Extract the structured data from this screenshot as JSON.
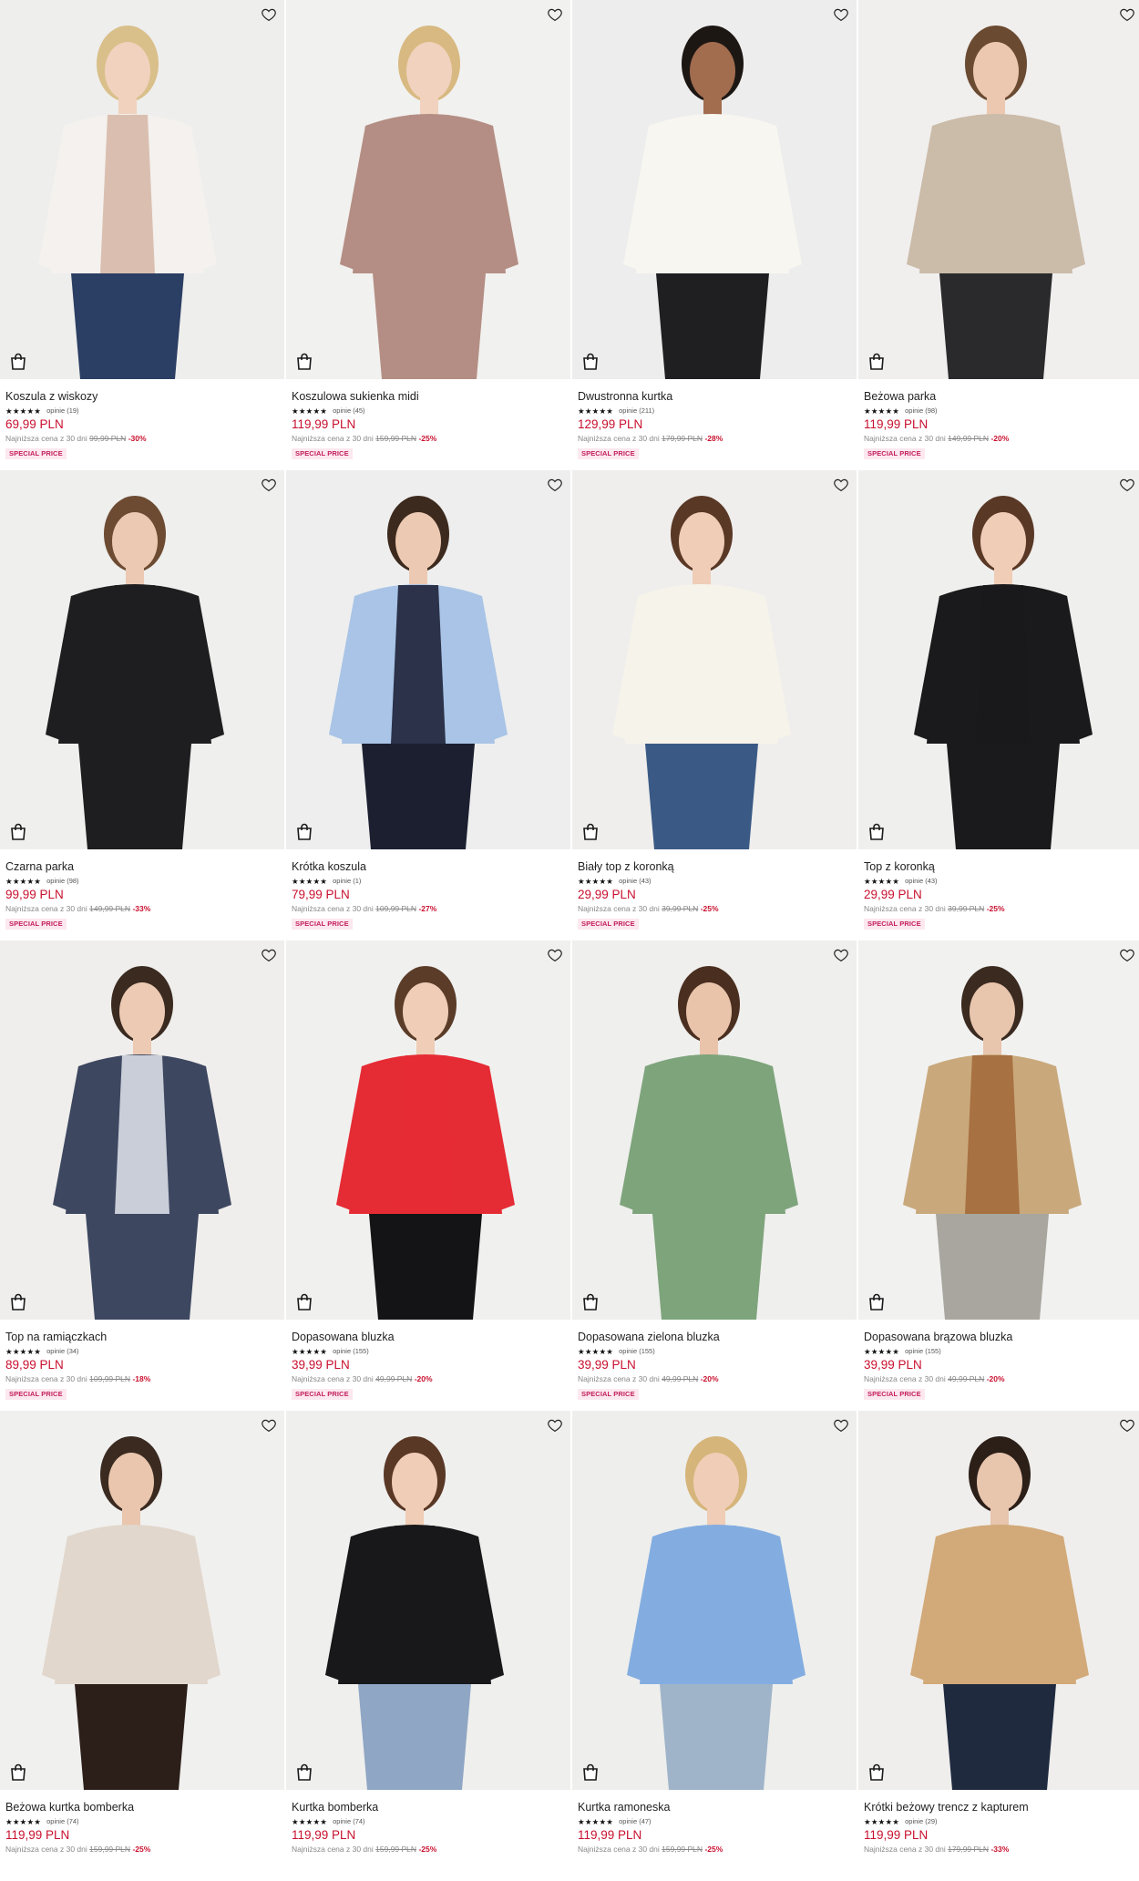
{
  "ui": {
    "wishlist_icon": "heart-outline-icon",
    "cart_icon": "shopping-bag-icon",
    "reviews_word": "opinie",
    "lowest_prefix": "Najniższa cena z 30 dni",
    "star_color": "#111111",
    "price_color": "#c8102e",
    "badge_bg": "#fde8ef",
    "badge_fg": "#c31e5c"
  },
  "products": [
    {
      "name": "Koszula z wiskozy",
      "stars": "★★★★★",
      "reviews": "opinie (19)",
      "price": "69,99 PLN",
      "lowest_label": "Najniższa cena z 30 dni",
      "lowest_old": "99,99 PLN",
      "discount": "-30%",
      "badge": "SPECIAL PRICE",
      "bg": "#eeeeec",
      "top": "#f4f1ee",
      "top2": "#d7b9a8",
      "bottom": "#2b3e63",
      "hair": "#d9bf8a",
      "skin": "#f0d2be"
    },
    {
      "name": "Koszulowa sukienka midi",
      "stars": "★★★★★",
      "reviews": "opinie (45)",
      "price": "119,99 PLN",
      "lowest_label": "Najniższa cena z 30 dni",
      "lowest_old": "159,99 PLN",
      "discount": "-25%",
      "badge": "SPECIAL PRICE",
      "bg": "#f1f1ef",
      "top": "#b48e84",
      "top2": "#b48e84",
      "bottom": "#b48e84",
      "hair": "#d8b981",
      "skin": "#f0d2be"
    },
    {
      "name": "Dwustronna kurtka",
      "stars": "★★★★★",
      "reviews": "opinie (211)",
      "price": "129,99 PLN",
      "lowest_label": "Najniższa cena z 30 dni",
      "lowest_old": "179,99 PLN",
      "discount": "-28%",
      "badge": "SPECIAL PRICE",
      "bg": "#ededed",
      "top": "#f7f6f1",
      "top2": "#f7f6f1",
      "bottom": "#1f1f22",
      "hair": "#1d1714",
      "skin": "#a26c4e"
    },
    {
      "name": "Beżowa parka",
      "stars": "★★★★★",
      "reviews": "opinie (98)",
      "price": "119,99 PLN",
      "lowest_label": "Najniższa cena z 30 dni",
      "lowest_old": "149,99 PLN",
      "discount": "-20%",
      "badge": "SPECIAL PRICE",
      "bg": "#f0efed",
      "top": "#cbbba9",
      "top2": "#cbbba9",
      "bottom": "#2a2a2d",
      "hair": "#6b4a32",
      "skin": "#ecc8b0"
    },
    {
      "name": "Czarna parka",
      "stars": "★★★★★",
      "reviews": "opinie (98)",
      "price": "99,99 PLN",
      "lowest_label": "Najniższa cena z 30 dni",
      "lowest_old": "149,99 PLN",
      "discount": "-33%",
      "badge": "SPECIAL PRICE",
      "bg": "#efefed",
      "top": "#1e1e20",
      "top2": "#1e1e20",
      "bottom": "#1e1e20",
      "hair": "#6d4b33",
      "skin": "#ecc9b2"
    },
    {
      "name": "Krótka koszula",
      "stars": "★★★★★",
      "reviews": "opinie (1)",
      "price": "79,99 PLN",
      "lowest_label": "Najniższa cena z 30 dni",
      "lowest_old": "109,99 PLN",
      "discount": "-27%",
      "badge": "SPECIAL PRICE",
      "bg": "#eeeeee",
      "top": "#a9c4e6",
      "top2": "#1d2238",
      "bottom": "#1b1f30",
      "hair": "#3d2a1e",
      "skin": "#ecc9b2"
    },
    {
      "name": "Biały top z koronką",
      "stars": "★★★★★",
      "reviews": "opinie (43)",
      "price": "29,99 PLN",
      "lowest_label": "Najniższa cena z 30 dni",
      "lowest_old": "39,99 PLN",
      "discount": "-25%",
      "badge": "SPECIAL PRICE",
      "bg": "#efeeec",
      "top": "#f6f3ea",
      "top2": "#f6f3ea",
      "bottom": "#3a5a85",
      "hair": "#5a3826",
      "skin": "#efcdb6"
    },
    {
      "name": "Top z koronką",
      "stars": "★★★★★",
      "reviews": "opinie (43)",
      "price": "29,99 PLN",
      "lowest_label": "Najniższa cena z 30 dni",
      "lowest_old": "39,99 PLN",
      "discount": "-25%",
      "badge": "SPECIAL PRICE",
      "bg": "#efefed",
      "top": "#1a1a1c",
      "top2": "#1a1a1c",
      "bottom": "#1a1a1c",
      "hair": "#5a3826",
      "skin": "#efcdb6"
    },
    {
      "name": "Top na ramiączkach",
      "stars": "★★★★★",
      "reviews": "opinie (34)",
      "price": "89,99 PLN",
      "lowest_label": "Najniższa cena z 30 dni",
      "lowest_old": "109,99 PLN",
      "discount": "-18%",
      "badge": "SPECIAL PRICE",
      "bg": "#efeeec",
      "top": "#3d4760",
      "top2": "#d9dde6",
      "bottom": "#3d4760",
      "hair": "#3a2a20",
      "skin": "#eccab4"
    },
    {
      "name": "Dopasowana bluzka",
      "stars": "★★★★★",
      "reviews": "opinie (155)",
      "price": "39,99 PLN",
      "lowest_label": "Najniższa cena z 30 dni",
      "lowest_old": "49,99 PLN",
      "discount": "-20%",
      "badge": "SPECIAL PRICE",
      "bg": "#f0f0ef",
      "top": "#e52b34",
      "top2": "#e52b34",
      "bottom": "#141416",
      "hair": "#5a3c28",
      "skin": "#efcdb6"
    },
    {
      "name": "Dopasowana zielona bluzka",
      "stars": "★★★★★",
      "reviews": "opinie (155)",
      "price": "39,99 PLN",
      "lowest_label": "Najniższa cena z 30 dni",
      "lowest_old": "49,99 PLN",
      "discount": "-20%",
      "badge": "SPECIAL PRICE",
      "bg": "#efefed",
      "top": "#7ea47c",
      "top2": "#7ea47c",
      "bottom": "#7ea47c",
      "hair": "#4a2f20",
      "skin": "#e9c4ab"
    },
    {
      "name": "Dopasowana brązowa bluzka",
      "stars": "★★★★★",
      "reviews": "opinie (155)",
      "price": "39,99 PLN",
      "lowest_label": "Najniższa cena z 30 dni",
      "lowest_old": "49,99 PLN",
      "discount": "-20%",
      "badge": "SPECIAL PRICE",
      "bg": "#f1f1f0",
      "top": "#c9a97c",
      "top2": "#a46a3b",
      "bottom": "#a9a69f",
      "hair": "#3a2a20",
      "skin": "#e8c5ad"
    },
    {
      "name": "Beżowa kurtka bomberka",
      "stars": "★★★★★",
      "reviews": "opinie (74)",
      "price": "119,99 PLN",
      "lowest_label": "Najniższa cena z 30 dni",
      "lowest_old": "159,99 PLN",
      "discount": "-25%",
      "badge": "",
      "bg": "#f0f0ef",
      "top": "#e2d7cc",
      "top2": "#e2d7cc",
      "bottom": "#2c1f1a",
      "hair": "#3a2a20",
      "skin": "#e9c6ad"
    },
    {
      "name": "Kurtka bomberka",
      "stars": "★★★★★",
      "reviews": "opinie (74)",
      "price": "119,99 PLN",
      "lowest_label": "Najniższa cena z 30 dni",
      "lowest_old": "159,99 PLN",
      "discount": "-25%",
      "badge": "",
      "bg": "#efefed",
      "top": "#18181b",
      "top2": "#18181b",
      "bottom": "#8fa6c4",
      "hair": "#5a3826",
      "skin": "#efcdb6"
    },
    {
      "name": "Kurtka ramoneska",
      "stars": "★★★★★",
      "reviews": "opinie (47)",
      "price": "119,99 PLN",
      "lowest_label": "Najniższa cena z 30 dni",
      "lowest_old": "159,99 PLN",
      "discount": "-25%",
      "badge": "",
      "bg": "#eeeeec",
      "top": "#83ade0",
      "top2": "#83ade0",
      "bottom": "#9fb4c9",
      "hair": "#d6b57b",
      "skin": "#efcdb6"
    },
    {
      "name": "Krótki beżowy trencz z kapturem",
      "stars": "★★★★★",
      "reviews": "opinie (29)",
      "price": "119,99 PLN",
      "lowest_label": "Najniższa cena z 30 dni",
      "lowest_old": "179,99 PLN",
      "discount": "-33%",
      "badge": "",
      "bg": "#efeeec",
      "top": "#d2a978",
      "top2": "#d2a978",
      "bottom": "#1f2a3f",
      "hair": "#2b1f18",
      "skin": "#e8c5ad"
    }
  ]
}
